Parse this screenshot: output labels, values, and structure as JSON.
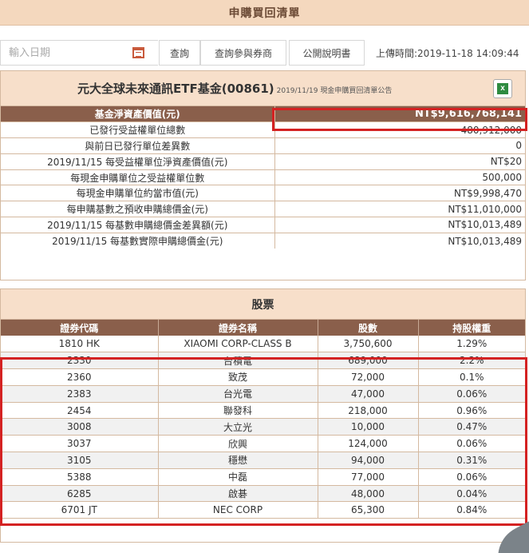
{
  "header": {
    "title": "申購買回清單"
  },
  "toolbar": {
    "date_placeholder": "輸入日期",
    "query_label": "查詢",
    "participant_label": "查詢參與券商",
    "prospectus_label": "公開說明書",
    "upload_time": "上傳時間:2019-11-18 14:09:44"
  },
  "fund": {
    "name": "元大全球未來通訊ETF基金(00861)",
    "note": "2019/11/19 現金申購買回清單公告",
    "rows": [
      {
        "label": "基金淨資產價值(元)",
        "value": "NT$9,616,768,141"
      },
      {
        "label": "已發行受益權單位總數",
        "value": "480,912,000"
      },
      {
        "label": "與前日已發行單位差異數",
        "value": "0"
      },
      {
        "label": "2019/11/15 每受益權單位淨資產價值(元)",
        "value": "NT$20"
      },
      {
        "label": "每現金申購單位之受益權單位數",
        "value": "500,000"
      },
      {
        "label": "每現金申購單位約當市值(元)",
        "value": "NT$9,998,470"
      },
      {
        "label": "每申購基數之預收申購總價金(元)",
        "value": "NT$11,010,000"
      },
      {
        "label": "2019/11/15 每基數申購總價金差異額(元)",
        "value": "NT$10,013,489"
      },
      {
        "label": "2019/11/15 每基數實際申購總價金(元)",
        "value": "NT$10,013,489"
      }
    ]
  },
  "stocks": {
    "title": "股票",
    "columns": [
      "證券代碼",
      "證券名稱",
      "股數",
      "持股權重"
    ],
    "rows": [
      {
        "code": "1810 HK",
        "name": "XIAOMI CORP-CLASS B",
        "shares": "3,750,600",
        "weight": "1.29%"
      },
      {
        "code": "2330",
        "name": "台積電",
        "shares": "689,000",
        "weight": "2.2%"
      },
      {
        "code": "2360",
        "name": "致茂",
        "shares": "72,000",
        "weight": "0.1%"
      },
      {
        "code": "2383",
        "name": "台光電",
        "shares": "47,000",
        "weight": "0.06%"
      },
      {
        "code": "2454",
        "name": "聯發科",
        "shares": "218,000",
        "weight": "0.96%"
      },
      {
        "code": "3008",
        "name": "大立光",
        "shares": "10,000",
        "weight": "0.47%"
      },
      {
        "code": "3037",
        "name": "欣興",
        "shares": "124,000",
        "weight": "0.06%"
      },
      {
        "code": "3105",
        "name": "穩懋",
        "shares": "94,000",
        "weight": "0.31%"
      },
      {
        "code": "5388",
        "name": "中磊",
        "shares": "77,000",
        "weight": "0.06%"
      },
      {
        "code": "6285",
        "name": "啟碁",
        "shares": "48,000",
        "weight": "0.04%"
      },
      {
        "code": "6701 JT",
        "name": "NEC CORP",
        "shares": "65,300",
        "weight": "0.84%"
      }
    ]
  },
  "colors": {
    "accent_brown": "#8a5f4b",
    "header_peach": "#f7dfca",
    "highlight_red": "#d42222"
  },
  "icons": {
    "calendar": "calendar-icon",
    "excel": "excel-icon"
  }
}
